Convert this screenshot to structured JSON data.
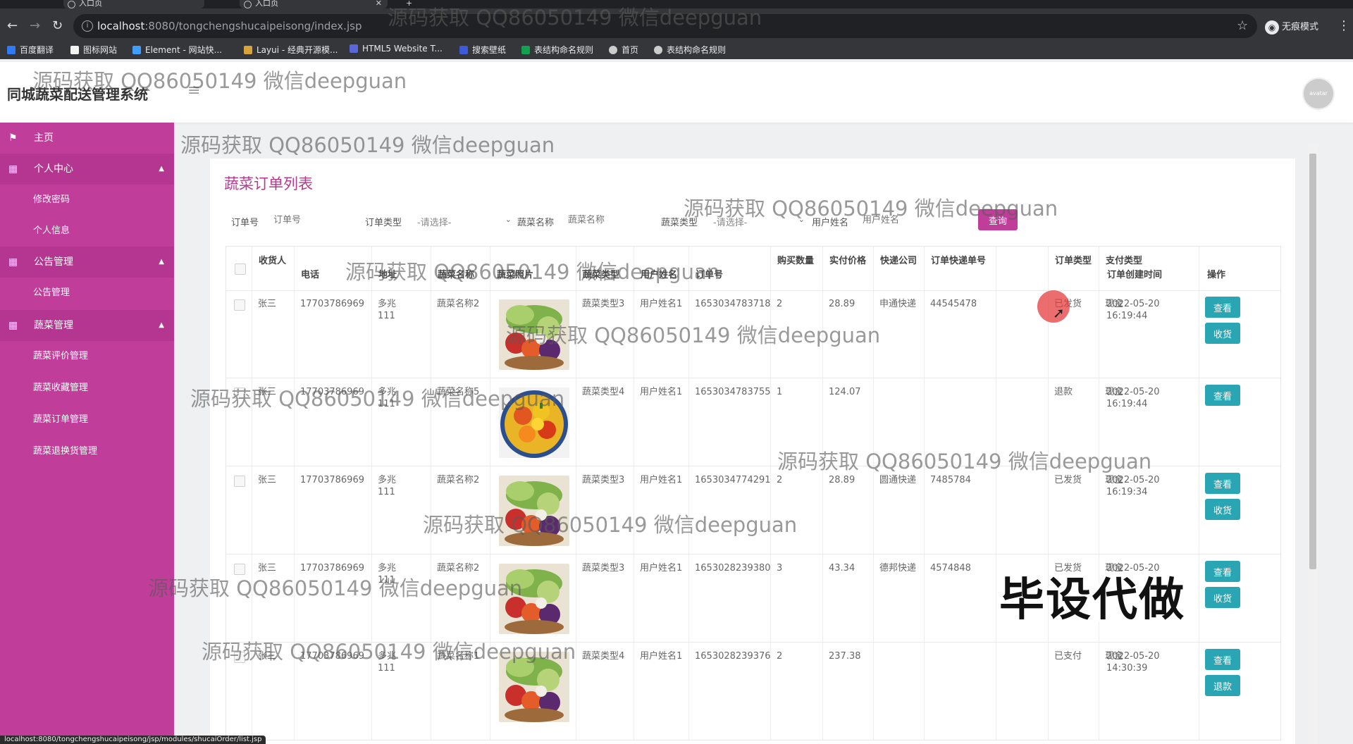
{
  "browser": {
    "tabs": [
      {
        "title": "入口页"
      },
      {
        "title": "入口页"
      }
    ],
    "url_host": "localhost",
    "url_path": ":8080/tongchengshucaipeisong/index.jsp",
    "incognito_label": "无痕模式",
    "bookmarks": [
      {
        "label": "百度翻译",
        "color": "#2f7bf6"
      },
      {
        "label": "图标网站",
        "color": "#f3f3f3"
      },
      {
        "label": "Element - 网站快...",
        "color": "#409eff"
      },
      {
        "label": "Layui - 经典开源模...",
        "color": "#d8a33b"
      },
      {
        "label": "HTML5 Website T...",
        "color": "#5a67d8"
      },
      {
        "label": "搜索壁纸",
        "color": "#3b5bdb"
      },
      {
        "label": "表结构命名规则",
        "color": "#12a150"
      },
      {
        "label": "首页",
        "color": "#cccccc"
      },
      {
        "label": "表结构命名规则",
        "color": "#cccccc"
      }
    ],
    "status_url": "localhost:8080/tongchengshucaipeisong/jsp/modules/shucaiOrder/list.jsp"
  },
  "app": {
    "title": "同城蔬菜配送管理系统",
    "avatar_text": "avatar",
    "accent_color": "#c13d9a",
    "button_color": "#2aa5b3"
  },
  "sidebar": {
    "items": [
      {
        "label": "主页",
        "icon": "flag-icon",
        "type": "top"
      },
      {
        "label": "个人中心",
        "icon": "grid-icon",
        "type": "group"
      },
      {
        "label": "修改密码",
        "type": "sub"
      },
      {
        "label": "个人信息",
        "type": "sub"
      },
      {
        "label": "公告管理",
        "icon": "grid-icon",
        "type": "group"
      },
      {
        "label": "公告管理",
        "type": "sub"
      },
      {
        "label": "蔬菜管理",
        "icon": "grid-icon",
        "type": "group"
      },
      {
        "label": "蔬菜评价管理",
        "type": "sub"
      },
      {
        "label": "蔬菜收藏管理",
        "type": "sub"
      },
      {
        "label": "蔬菜订单管理",
        "type": "sub"
      },
      {
        "label": "蔬菜退换货管理",
        "type": "sub"
      }
    ]
  },
  "page": {
    "title": "蔬菜订单列表",
    "filters": {
      "order_no_label": "订单号",
      "order_no_placeholder": "订单号",
      "order_type_label": "订单类型",
      "order_type_value": "-请选择-",
      "veg_name_label": "蔬菜名称",
      "veg_name_placeholder": "蔬菜名称",
      "veg_type_label": "蔬菜类型",
      "veg_type_value": "-请选择-",
      "user_name_label": "用户姓名",
      "user_name_placeholder": "用户姓名",
      "query_button": "查询"
    },
    "columns": [
      "收货人",
      "电话",
      "地址",
      "蔬菜名称",
      "蔬菜照片",
      "蔬菜类型",
      "用户姓名",
      "订单号",
      "购买数量",
      "实付价格",
      "快递公司",
      "订单快递单号",
      "订单类型",
      "支付类型",
      "订单创建时间",
      "操作"
    ],
    "rows": [
      {
        "receiver": "张三",
        "phone": "17703786969",
        "address": "多兆111",
        "veg_name": "蔬菜名称2",
        "veg_type": "蔬菜类型3",
        "user": "用户姓名1",
        "order_no": "1653034783718",
        "qty": "2",
        "price": "28.89",
        "courier": "申通快递",
        "tracking": "44545478",
        "order_type": "已发货",
        "pay_type": "现金",
        "created": "2022-05-20 16:19:44",
        "buttons": [
          "查看",
          "收货"
        ],
        "photo": "veg-basket"
      },
      {
        "receiver": "张三",
        "phone": "17703786969",
        "address": "多兆111",
        "veg_name": "蔬菜名称5",
        "veg_type": "蔬菜类型4",
        "user": "用户姓名1",
        "order_no": "1653034783755",
        "qty": "1",
        "price": "124.07",
        "courier": "",
        "tracking": "",
        "order_type": "退款",
        "pay_type": "现金",
        "created": "2022-05-20 16:19:44",
        "buttons": [
          "查看"
        ],
        "photo": "peppers-bowl"
      },
      {
        "receiver": "张三",
        "phone": "17703786969",
        "address": "多兆111",
        "veg_name": "蔬菜名称2",
        "veg_type": "蔬菜类型3",
        "user": "用户姓名1",
        "order_no": "1653034774291",
        "qty": "2",
        "price": "28.89",
        "courier": "圆通快递",
        "tracking": "7485784",
        "order_type": "已发货",
        "pay_type": "现金",
        "created": "2022-05-20 16:19:34",
        "buttons": [
          "查看",
          "收货"
        ],
        "photo": "veg-basket"
      },
      {
        "receiver": "张三",
        "phone": "17703786969",
        "address": "多兆111",
        "veg_name": "蔬菜名称2",
        "veg_type": "蔬菜类型3",
        "user": "用户姓名1",
        "order_no": "1653028239380",
        "qty": "3",
        "price": "43.34",
        "courier": "德邦快递",
        "tracking": "4574848",
        "order_type": "已发货",
        "pay_type": "现金",
        "created": "2022-05-20",
        "buttons": [
          "查看",
          "收货"
        ],
        "photo": "veg-basket"
      },
      {
        "receiver": "张三",
        "phone": "17703786969",
        "address": "多兆111",
        "veg_name": "蔬菜名称1",
        "veg_type": "蔬菜类型4",
        "user": "用户姓名1",
        "order_no": "1653028239376",
        "qty": "2",
        "price": "237.38",
        "courier": "",
        "tracking": "",
        "order_type": "已支付",
        "pay_type": "现金",
        "created": "2022-05-20 14:30:39",
        "buttons": [
          "查看",
          "退款"
        ],
        "photo": "veg-basket"
      }
    ]
  },
  "overlays": {
    "watermark": "源码获取 QQ86050149 微信deepguan",
    "promo": "毕设代做"
  }
}
